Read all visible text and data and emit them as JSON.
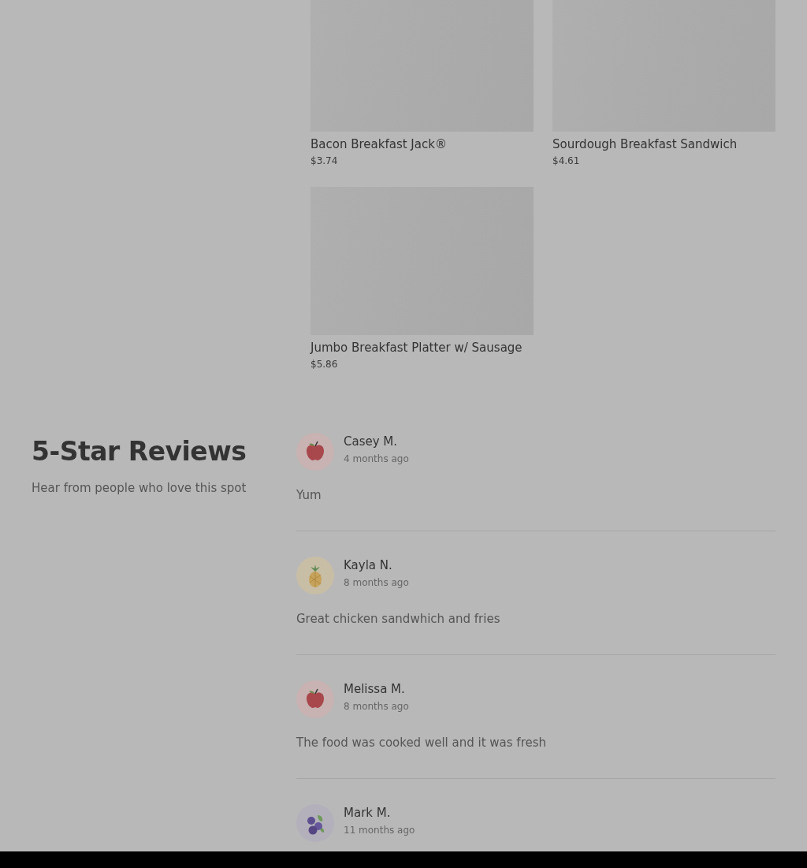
{
  "menu_items": [
    {
      "kind": "placeholder",
      "name": "Bacon Breakfast Jack®",
      "price": "$3.74"
    },
    {
      "kind": "placeholder",
      "name": "Sourdough Breakfast Sandwich",
      "price": "$4.61"
    },
    {
      "kind": "placeholder",
      "name": "Jumbo Breakfast Platter w/ Sausage",
      "price": "$5.86"
    }
  ],
  "reviews_section": {
    "title": "5-Star Reviews",
    "subtitle": "Hear from people who love this spot"
  },
  "reviews": [
    {
      "kind": "apple",
      "name": "Casey M.",
      "time": "4 months ago",
      "text": "Yum"
    },
    {
      "kind": "pineapple",
      "name": "Kayla N.",
      "time": "8 months ago",
      "text": "Great chicken sandwhich and fries"
    },
    {
      "kind": "apple",
      "name": "Melissa M.",
      "time": "8 months ago",
      "text": "The food was cooked well and it was fresh"
    },
    {
      "kind": "blueberry",
      "name": "Mark M.",
      "time": "11 months ago"
    }
  ]
}
